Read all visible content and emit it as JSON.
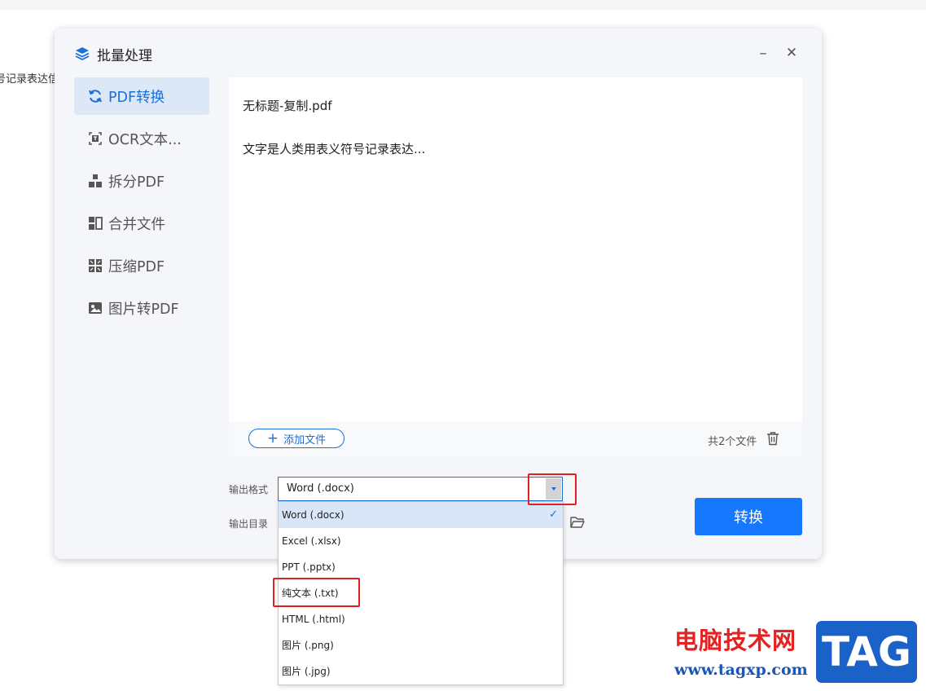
{
  "background": {
    "text": "号记录表达信"
  },
  "dialog": {
    "title": "批量处理",
    "minimize_label": "–",
    "close_label": "✕"
  },
  "sidebar": {
    "items": [
      {
        "label": "PDF转换",
        "icon": "refresh-icon",
        "active": true
      },
      {
        "label": "OCR文本...",
        "icon": "ocr-text-icon",
        "active": false
      },
      {
        "label": "拆分PDF",
        "icon": "split-icon",
        "active": false
      },
      {
        "label": "合并文件",
        "icon": "merge-icon",
        "active": false
      },
      {
        "label": "压缩PDF",
        "icon": "compress-icon",
        "active": false
      },
      {
        "label": "图片转PDF",
        "icon": "image-icon",
        "active": false
      }
    ]
  },
  "files": [
    {
      "name": "无标题-复制.pdf"
    },
    {
      "name": "文字是人类用表义符号记录表达..."
    }
  ],
  "footer": {
    "add_button": "添加文件",
    "count": "共2个文件"
  },
  "output": {
    "format_label": "输出格式",
    "dir_label": "输出目录",
    "selected_format": "Word (.docx)",
    "convert_button": "转换"
  },
  "dropdown": {
    "options": [
      {
        "label": "Word (.docx)",
        "selected": true
      },
      {
        "label": "Excel (.xlsx)",
        "selected": false
      },
      {
        "label": "PPT (.pptx)",
        "selected": false
      },
      {
        "label": "纯文本 (.txt)",
        "selected": false
      },
      {
        "label": "HTML (.html)",
        "selected": false
      },
      {
        "label": "图片 (.png)",
        "selected": false
      },
      {
        "label": "图片 (.jpg)",
        "selected": false
      }
    ],
    "check_mark": "✓"
  },
  "watermark": {
    "cn": "电脑技术网",
    "url": "www.tagxp.com",
    "logo": "TAG"
  },
  "colors": {
    "accent": "#1677ff",
    "highlight_box": "#e02020",
    "active_bg": "#dce8f6"
  }
}
